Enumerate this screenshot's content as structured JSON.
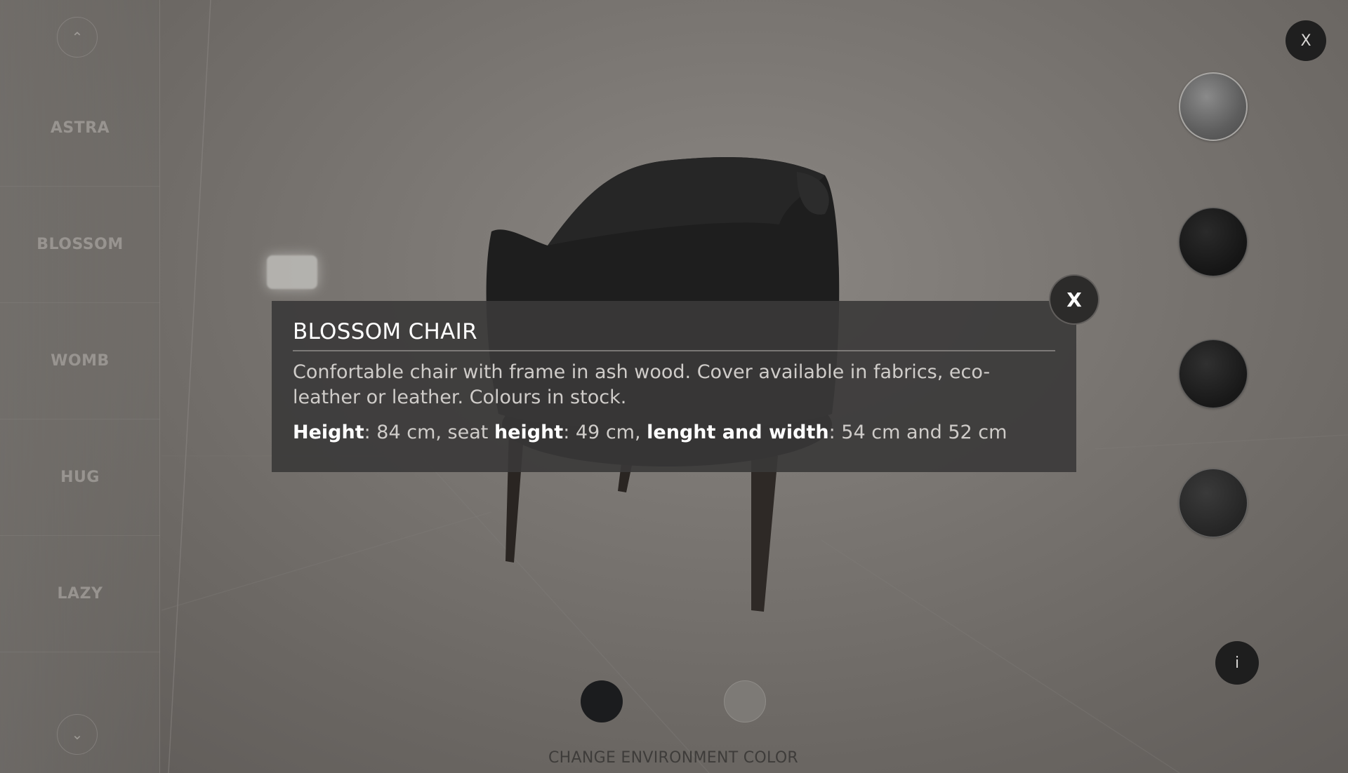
{
  "sidebar": {
    "items": [
      {
        "label": "ASTRA"
      },
      {
        "label": "BLOSSOM"
      },
      {
        "label": "WOMB"
      },
      {
        "label": "HUG"
      },
      {
        "label": "LAZY"
      }
    ],
    "up_icon": "chevron-up-icon",
    "down_icon": "chevron-down-icon"
  },
  "info": {
    "title": "BLOSSOM CHAIR",
    "description": "Confortable chair with frame in ash wood. Cover available in fabrics, eco-leather or leather. Colours in stock.",
    "dims": {
      "label1": "Height",
      "val1": ": 84 cm, seat ",
      "label2": "height",
      "val2": ": 49 cm, ",
      "label3": "lenght and width",
      "val3": ": 54 cm and 52 cm"
    },
    "close_label": "X"
  },
  "top_close_label": "X",
  "info_button_label": "i",
  "swatches": [
    {
      "name": "gray-fabric",
      "color": "#6e6e6e"
    },
    {
      "name": "black-leather",
      "color": "#1c1c1c"
    },
    {
      "name": "black-velvet",
      "color": "#202020"
    },
    {
      "name": "charcoal-fabric",
      "color": "#2e2e2e"
    }
  ],
  "environment": {
    "label": "CHANGE ENVIRONMENT COLOR",
    "options": [
      {
        "name": "dark",
        "color": "#1b1c1e"
      },
      {
        "name": "gray",
        "color": "#7d7a76"
      }
    ]
  }
}
